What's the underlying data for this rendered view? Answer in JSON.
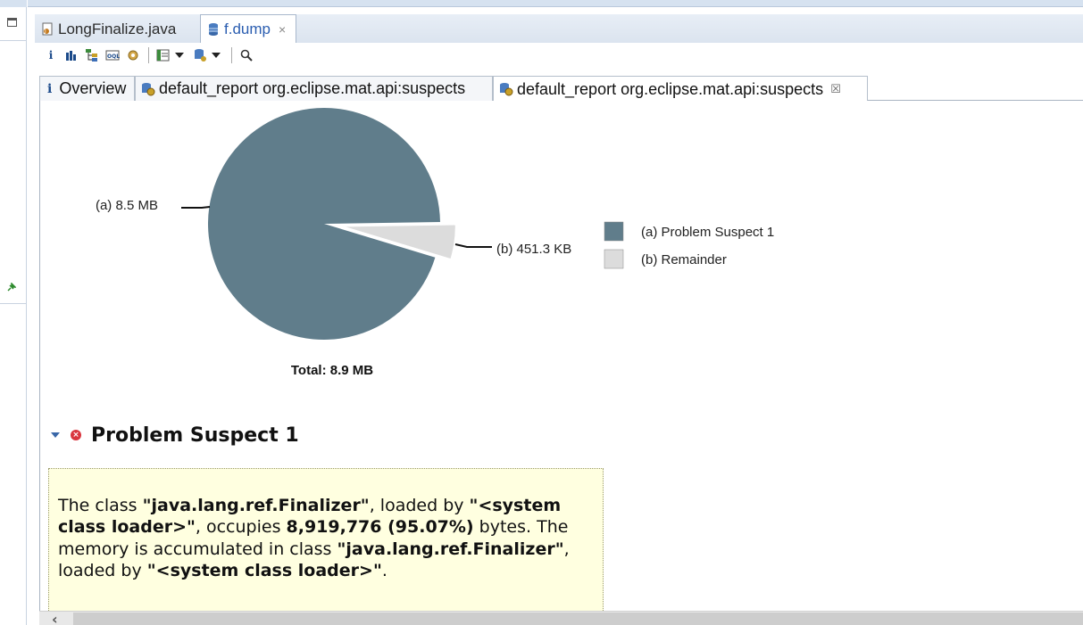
{
  "editor_tabs": [
    {
      "label": "LongFinalize.java",
      "active": false
    },
    {
      "label": "f.dump",
      "active": true,
      "close": "×"
    }
  ],
  "toolbar": {
    "icons": [
      "info-icon",
      "histogram-icon",
      "dominator-tree-icon",
      "oql-icon",
      "thread-overview-icon",
      "query-browser-icon",
      "heap-dump-overview-icon",
      "search-icon"
    ]
  },
  "inner_tabs": [
    {
      "label": "Overview",
      "icon": "info-icon"
    },
    {
      "label": "default_report  org.eclipse.mat.api:suspects",
      "icon": "report-db-icon"
    },
    {
      "label": "default_report  org.eclipse.mat.api:suspects",
      "icon": "report-db-icon",
      "active": true,
      "close": "☒"
    }
  ],
  "chart_data": {
    "type": "pie",
    "slices": [
      {
        "label": "(a)  8.5 MB",
        "legend": "(a)  Problem Suspect 1",
        "value_mb": 8.5,
        "color": "#607d8b",
        "exploded": false
      },
      {
        "label": "(b)  451.3 KB",
        "legend": "(b)  Remainder",
        "value_kb": 451.3,
        "value_mb": 0.4407,
        "color": "#dcdcdc",
        "exploded": true
      }
    ],
    "total": "Total: 8.9 MB",
    "legend_position": "right"
  },
  "suspect": {
    "title": "Problem Suspect 1",
    "t1": "The class ",
    "b1": "\"java.lang.ref.Finalizer\"",
    "t2": ", loaded by ",
    "b2": "\"<system class loader>\"",
    "t3": ", occupies ",
    "b3": "8,919,776 (95.07%)",
    "t4": " bytes. The memory is accumulated in class ",
    "b4": "\"java.lang.ref.Finalizer\"",
    "t5": ", loaded by ",
    "b5": "\"<system class loader>\"",
    "t6": "."
  },
  "colors": {
    "accent": "#607d8b",
    "remainder": "#dcdcdc",
    "box_bg": "#ffffe0",
    "error": "#d9363e"
  }
}
